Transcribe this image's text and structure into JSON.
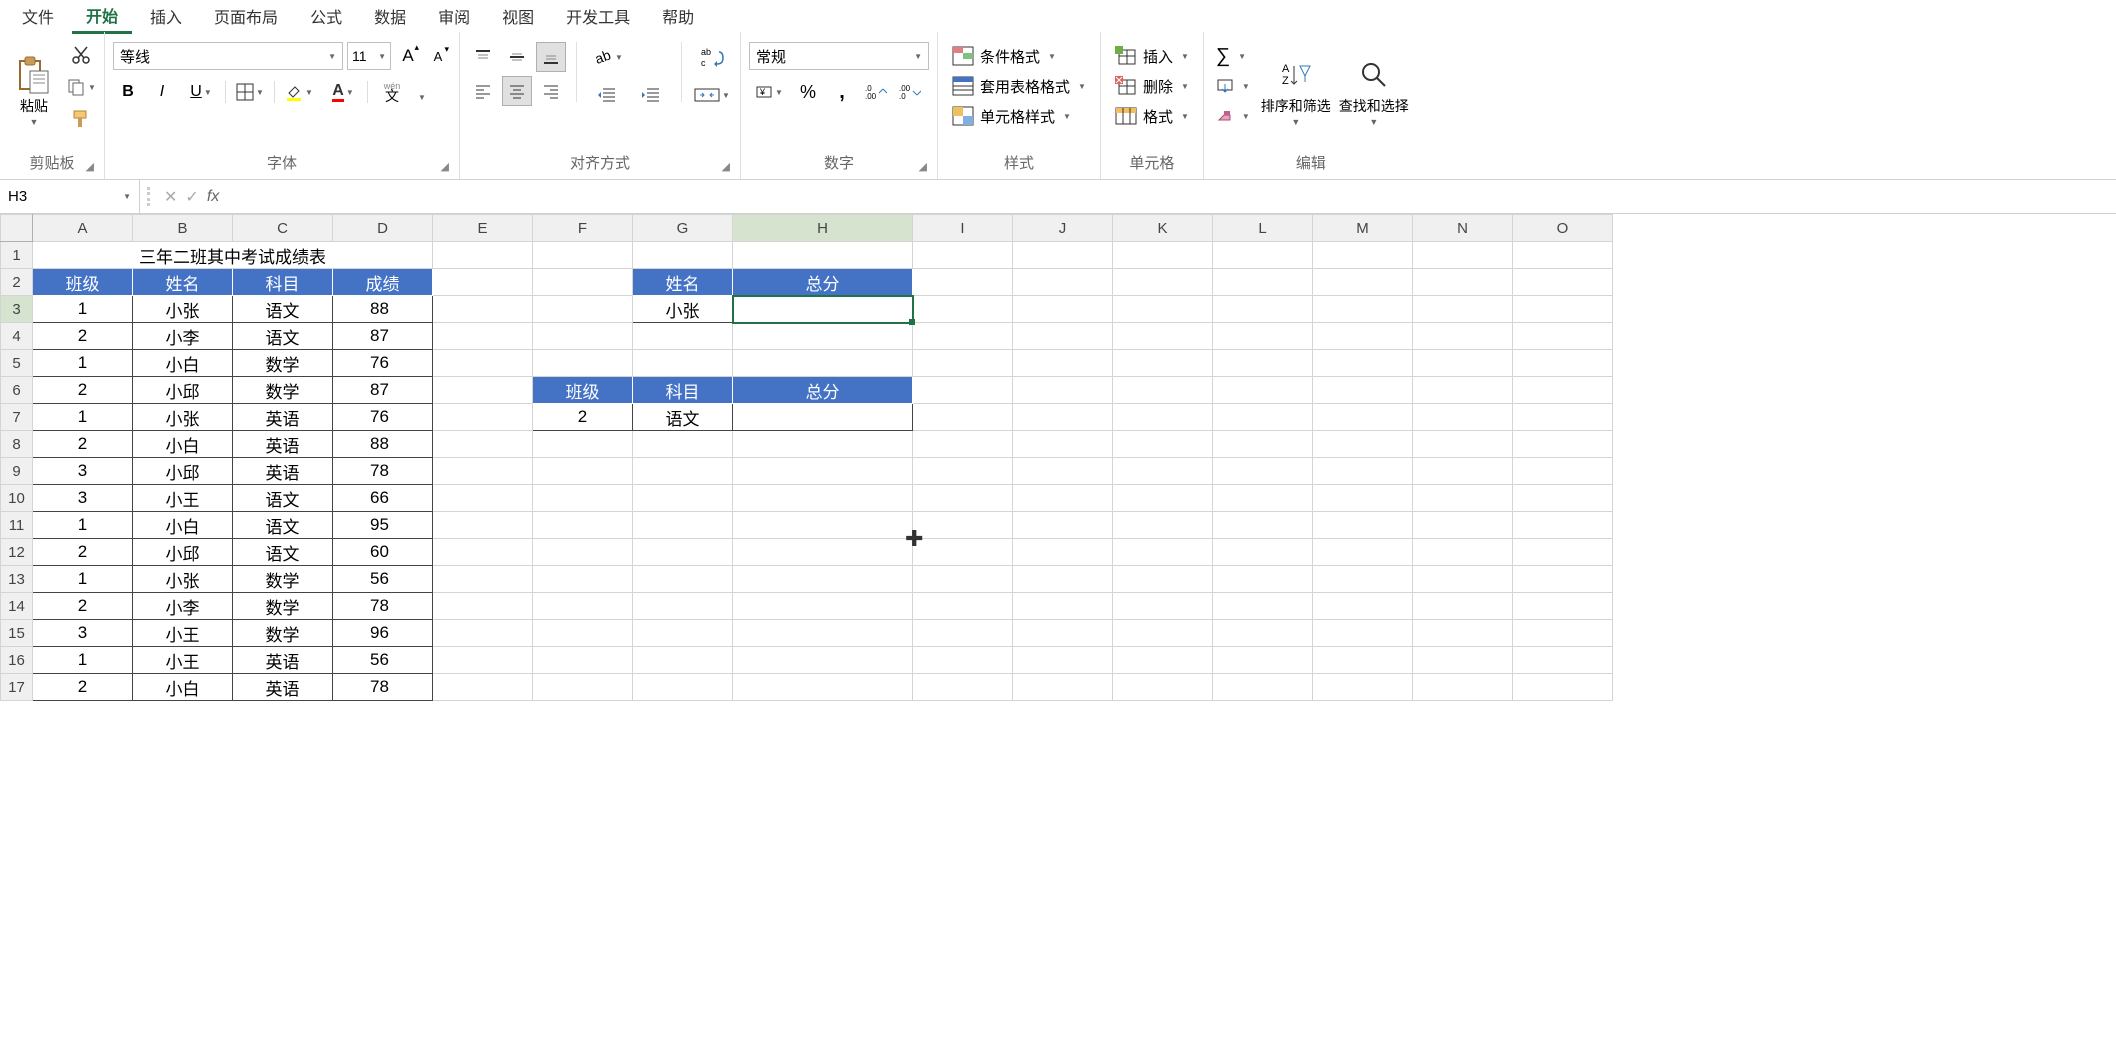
{
  "menu": {
    "items": [
      "文件",
      "开始",
      "插入",
      "页面布局",
      "公式",
      "数据",
      "审阅",
      "视图",
      "开发工具",
      "帮助"
    ],
    "active_index": 1
  },
  "ribbon": {
    "clipboard": {
      "label": "剪贴板",
      "paste": "粘贴"
    },
    "font": {
      "label": "字体",
      "name": "等线",
      "size": "11",
      "pinyin": "wén",
      "pinyin_char": "文"
    },
    "alignment": {
      "label": "对齐方式"
    },
    "number": {
      "label": "数字",
      "format": "常规"
    },
    "styles": {
      "label": "样式",
      "cond": "条件格式",
      "table": "套用表格格式",
      "cell": "单元格样式"
    },
    "cells": {
      "label": "单元格",
      "insert": "插入",
      "delete": "删除",
      "format": "格式"
    },
    "editing": {
      "label": "编辑",
      "sort": "排序和筛选",
      "find": "查找和选择"
    }
  },
  "formula_bar": {
    "name_box": "H3",
    "formula": ""
  },
  "columns": [
    "A",
    "B",
    "C",
    "D",
    "E",
    "F",
    "G",
    "H",
    "I",
    "J",
    "K",
    "L",
    "M",
    "N",
    "O"
  ],
  "sheet": {
    "title": "三年二班其中考试成绩表",
    "main_headers": [
      "班级",
      "姓名",
      "科目",
      "成绩"
    ],
    "rows": [
      {
        "class": "1",
        "name": "小张",
        "subject": "语文",
        "score": "88"
      },
      {
        "class": "2",
        "name": "小李",
        "subject": "语文",
        "score": "87"
      },
      {
        "class": "1",
        "name": "小白",
        "subject": "数学",
        "score": "76"
      },
      {
        "class": "2",
        "name": "小邱",
        "subject": "数学",
        "score": "87"
      },
      {
        "class": "1",
        "name": "小张",
        "subject": "英语",
        "score": "76"
      },
      {
        "class": "2",
        "name": "小白",
        "subject": "英语",
        "score": "88"
      },
      {
        "class": "3",
        "name": "小邱",
        "subject": "英语",
        "score": "78"
      },
      {
        "class": "3",
        "name": "小王",
        "subject": "语文",
        "score": "66"
      },
      {
        "class": "1",
        "name": "小白",
        "subject": "语文",
        "score": "95"
      },
      {
        "class": "2",
        "name": "小邱",
        "subject": "语文",
        "score": "60"
      },
      {
        "class": "1",
        "name": "小张",
        "subject": "数学",
        "score": "56"
      },
      {
        "class": "2",
        "name": "小李",
        "subject": "数学",
        "score": "78"
      },
      {
        "class": "3",
        "name": "小王",
        "subject": "数学",
        "score": "96"
      },
      {
        "class": "1",
        "name": "小王",
        "subject": "英语",
        "score": "56"
      },
      {
        "class": "2",
        "name": "小白",
        "subject": "英语",
        "score": "78"
      }
    ],
    "summary1": {
      "headers": [
        "姓名",
        "总分"
      ],
      "name": "小张",
      "total": ""
    },
    "summary2": {
      "headers": [
        "班级",
        "科目",
        "总分"
      ],
      "class": "2",
      "subject": "语文",
      "total": ""
    }
  },
  "active_cell": {
    "col": "H",
    "row": 3
  }
}
